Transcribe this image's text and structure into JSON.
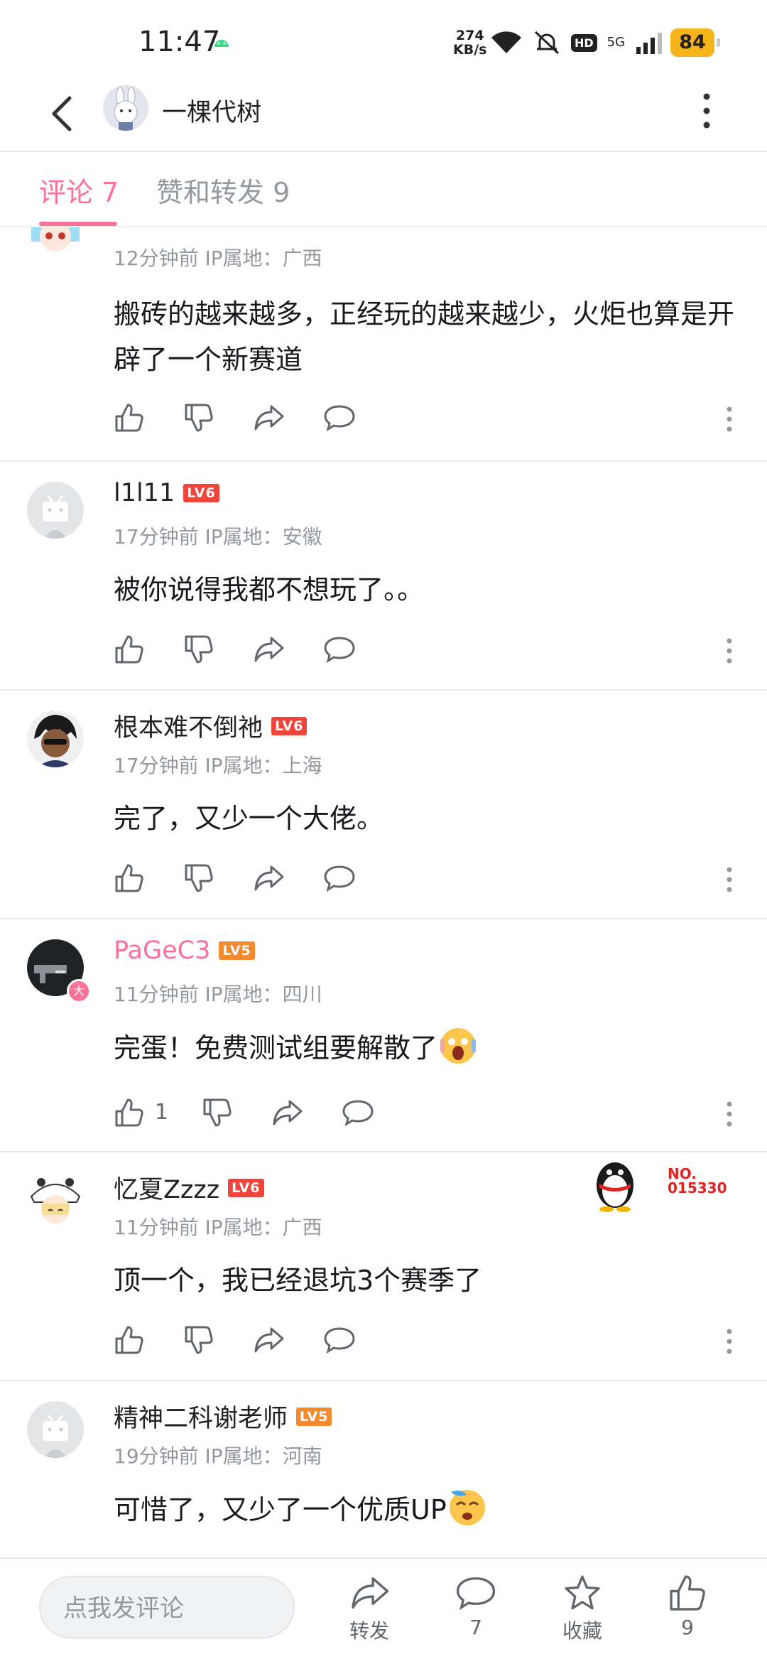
{
  "status_bar": {
    "time": "11:47",
    "net_speed_value": "274",
    "net_speed_unit": "KB/s",
    "hd": "HD",
    "network": "5G",
    "battery": "84"
  },
  "header": {
    "title": "一棵代树"
  },
  "tabs": [
    {
      "label": "评论 7",
      "active": true
    },
    {
      "label": "赞和转发 9",
      "active": false
    }
  ],
  "comments": [
    {
      "name": "",
      "time": "12分钟前 IP属地：广西",
      "text": "搬砖的越来越多，正经玩的越来越少，火炬也算是开辟了一个新赛道",
      "likes": ""
    },
    {
      "name": "l1l11",
      "level": "LV6",
      "time": "17分钟前 IP属地：安徽",
      "text": "被你说得我都不想玩了。。",
      "likes": ""
    },
    {
      "name": "根本难不倒祂",
      "level": "LV6",
      "time": "17分钟前 IP属地：上海",
      "text": "完了，又少一个大佬。",
      "likes": ""
    },
    {
      "name": "PaGeC3",
      "level": "LV5",
      "badge": "大",
      "time": "11分钟前 IP属地：四川",
      "text": "完蛋！免费测试组要解散了",
      "likes": "1"
    },
    {
      "name": "忆夏Zzzz",
      "level": "LV6",
      "time": "11分钟前 IP属地：广西",
      "text": "顶一个，我已经退坑3个赛季了",
      "likes": "",
      "fan_badge_no": "NO.",
      "fan_badge_num": "015330"
    },
    {
      "name": "精神二科谢老师",
      "level": "LV5",
      "time": "19分钟前 IP属地：河南",
      "text": "可惜了，又少了一个优质UP",
      "likes": ""
    }
  ],
  "bottom_bar": {
    "placeholder": "点我发评论",
    "share_label": "转发",
    "comment_count": "7",
    "fav_label": "收藏",
    "like_count": "9"
  },
  "colors": {
    "accent": "#fb7299",
    "lv6": "#f0453b",
    "lv5": "#f28a30",
    "battery": "#f4b41a"
  }
}
